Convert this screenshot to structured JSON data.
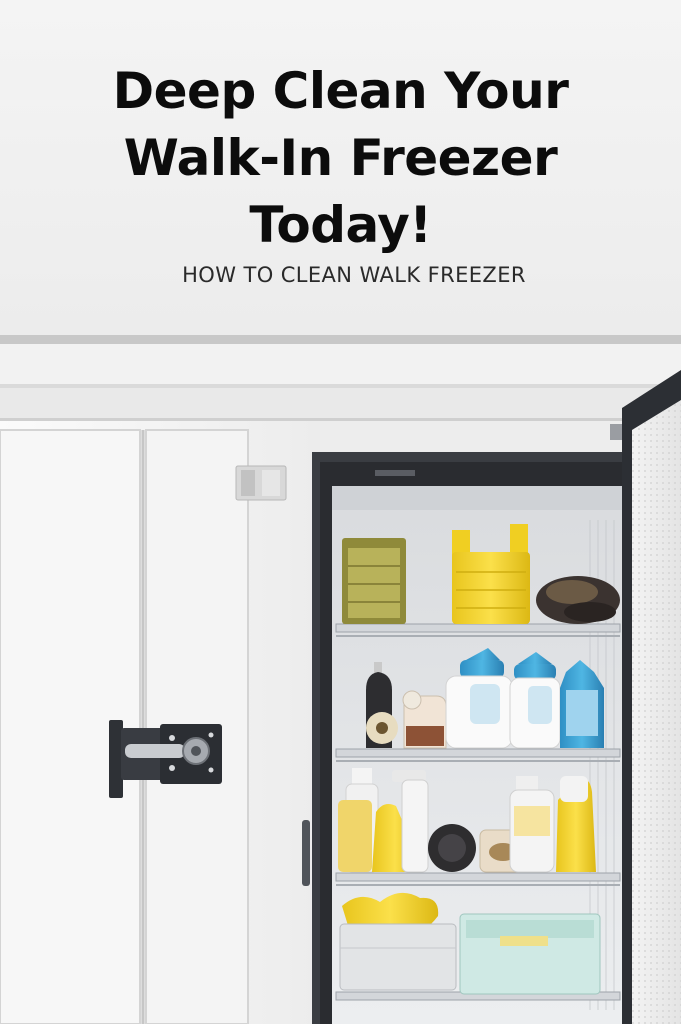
{
  "title_lines": [
    "Deep Clean Your",
    "Walk-In Freezer",
    "Today!"
  ],
  "subtitle": "HOW TO CLEAN WALK FREEZER",
  "colors": {
    "background": "#ededed",
    "title_text": "#0c0c0c",
    "accent_yellow": "#f2d52a",
    "accent_blue": "#3aa6d6",
    "freezer_panel": "#f6f6f6",
    "door_frame": "#3a3d42"
  },
  "icons": [
    "door-latch-icon",
    "hinge-icon",
    "door-handle-icon"
  ]
}
